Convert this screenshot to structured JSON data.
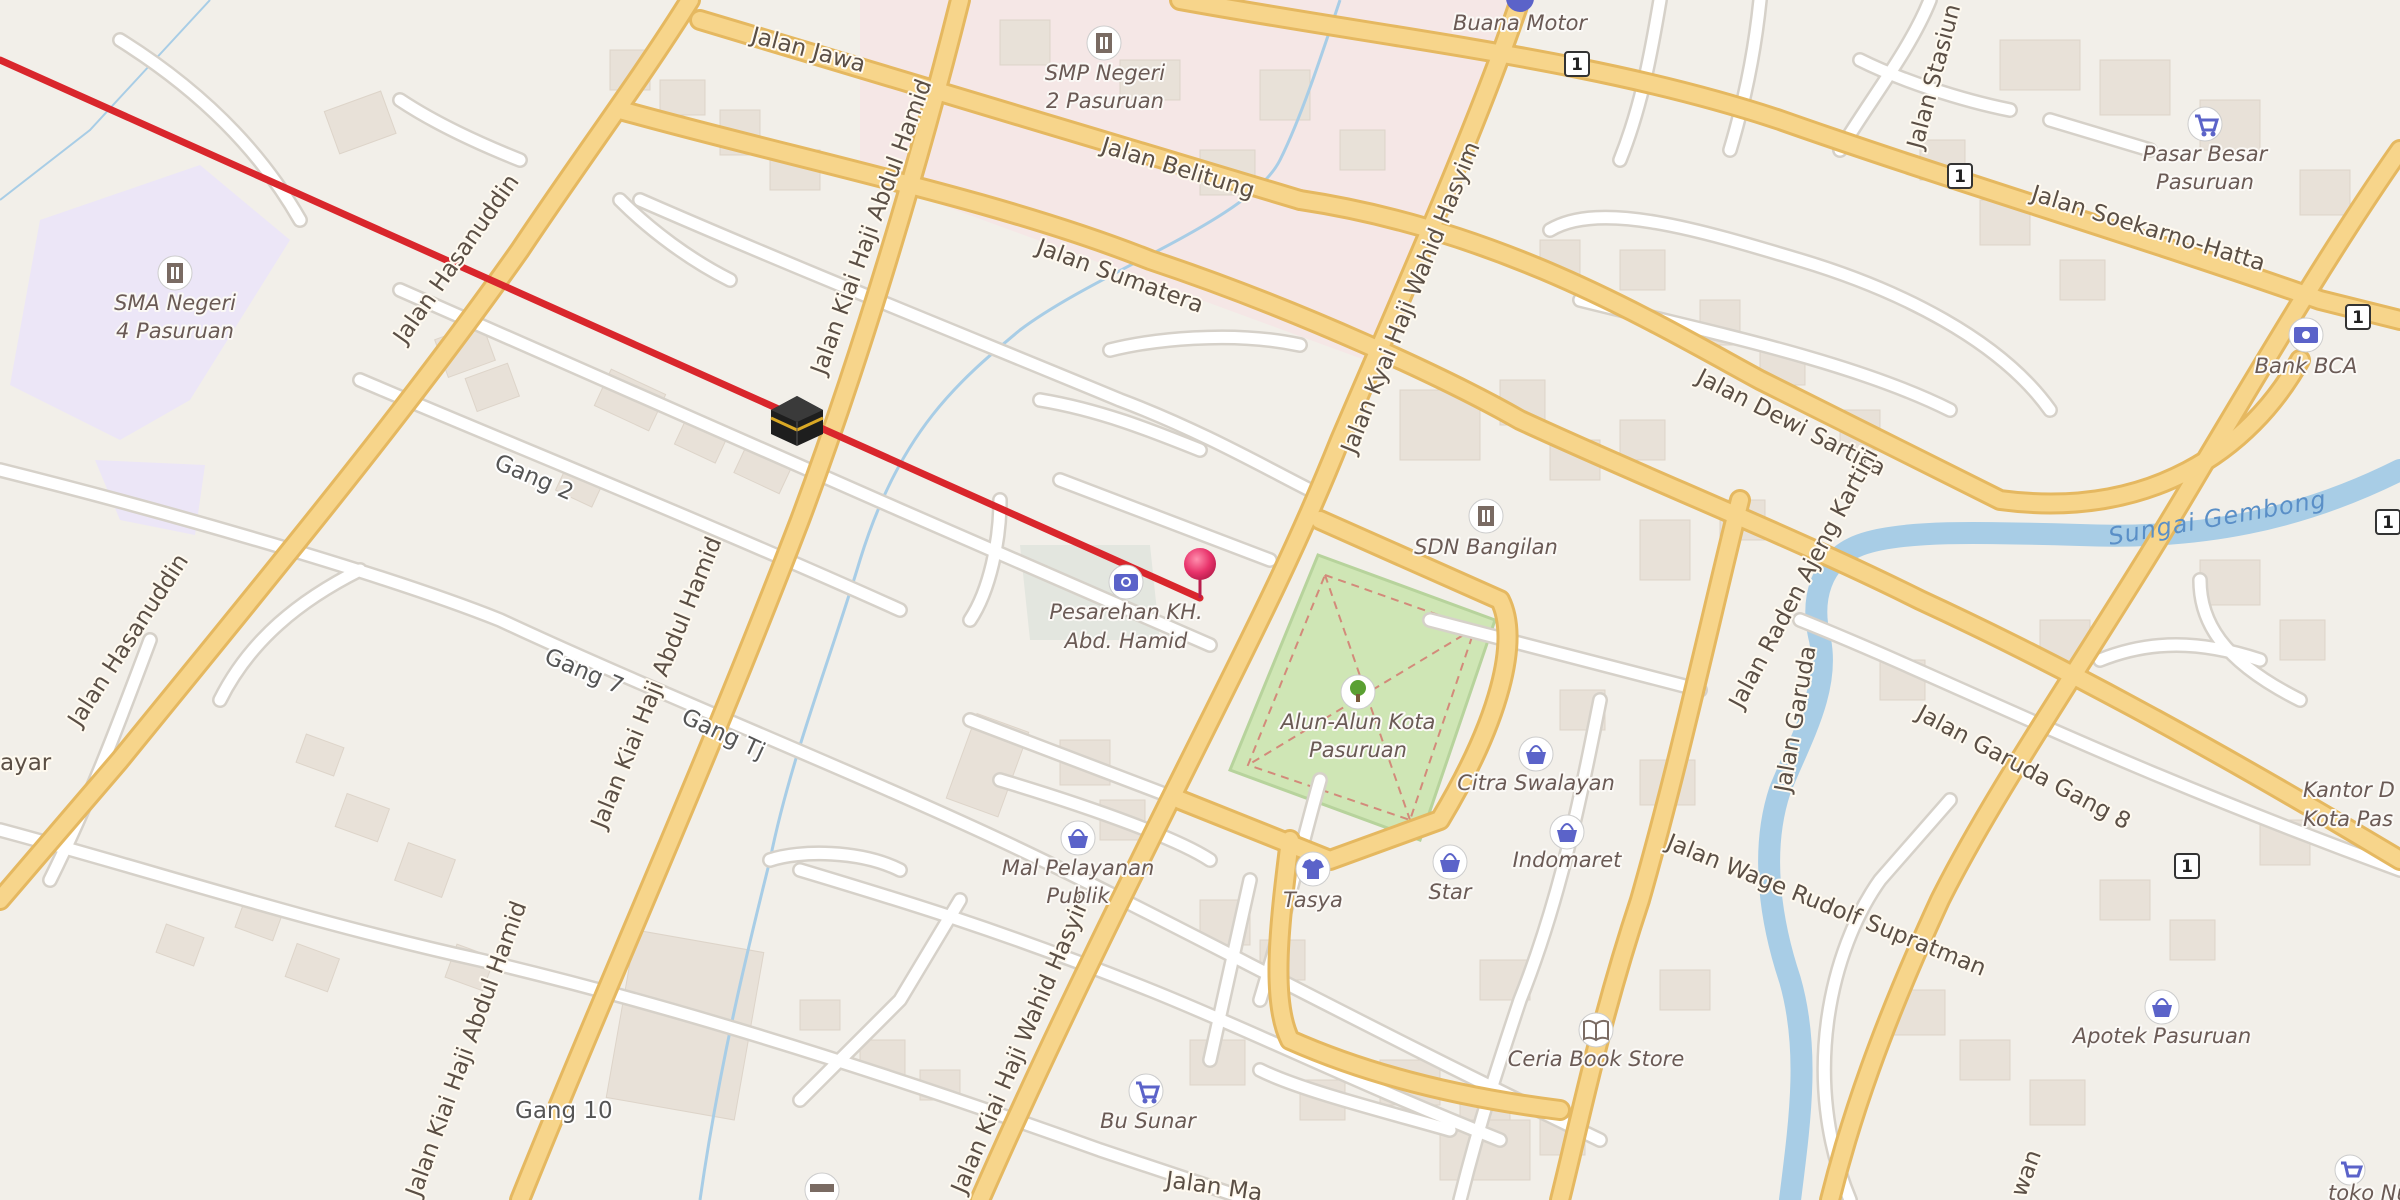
{
  "map": {
    "colors": {
      "background": "#f2efe9",
      "major_road": "#f7d58b",
      "major_road_casing": "#e5b860",
      "minor_road": "#ffffff",
      "minor_road_casing": "#d6d1c9",
      "building": "#e8e1d8",
      "water": "#a8cde6",
      "park": "#cfe6b5",
      "school_area": "#ece6f7",
      "commercial_area": "#f4e6e6",
      "route_line": "#d9262c",
      "pin": "#e8336b",
      "poi_shop": "#5b63c9",
      "poi_school": "#7a6b63",
      "poi_park": "#5aa032"
    },
    "road_labels": [
      {
        "id": "jalan-jawa",
        "text": "Jalan Jawa"
      },
      {
        "id": "jalan-belitung",
        "text": "Jalan Belitung"
      },
      {
        "id": "jalan-sumatera",
        "text": "Jalan Sumatera"
      },
      {
        "id": "jalan-hasanuddin-top",
        "text": "Jalan Hasanuddin"
      },
      {
        "id": "jalan-hasanuddin-bottom",
        "text": "Jalan Hasanuddin"
      },
      {
        "id": "jalan-kh-abdul-hamid-top",
        "text": "Jalan Kiai Haji Abdul Hamid"
      },
      {
        "id": "jalan-kh-abdul-hamid-mid",
        "text": "Jalan Kiai Haji Abdul Hamid"
      },
      {
        "id": "jalan-kh-abdul-hamid-bottom",
        "text": "Jalan Kiai Haji Abdul Hamid"
      },
      {
        "id": "jalan-kh-wahid-hasyim-top",
        "text": "Jalan Kyai Haji Wahid Hasyim"
      },
      {
        "id": "jalan-kh-wahid-hasyim-bottom",
        "text": "Jalan Kiai Haji Wahid Hasyim"
      },
      {
        "id": "jalan-dewi-sartika",
        "text": "Jalan Dewi Sartika"
      },
      {
        "id": "jalan-soekarno-hatta",
        "text": "Jalan Soekarno-Hatta"
      },
      {
        "id": "jalan-stasiun",
        "text": "Jalan Stasiun"
      },
      {
        "id": "jalan-raden-ajeng-kartini",
        "text": "Jalan Raden Ajeng Kartini"
      },
      {
        "id": "jalan-garuda",
        "text": "Jalan Garuda"
      },
      {
        "id": "jalan-garuda-gang-8",
        "text": "Jalan Garuda Gang 8"
      },
      {
        "id": "jalan-wage-rudolf-supratman",
        "text": "Jalan Wage Rudolf Supratman"
      },
      {
        "id": "gang-2",
        "text": "Gang 2"
      },
      {
        "id": "gang-7",
        "text": "Gang 7"
      },
      {
        "id": "gang-tj",
        "text": "Gang Tj"
      },
      {
        "id": "gang-10",
        "text": "Gang 10"
      },
      {
        "id": "jalan-ma-bottom",
        "text": "Jalan Ma"
      },
      {
        "id": "wan-bottom",
        "text": "wan"
      },
      {
        "id": "ayar-left",
        "text": "ayar"
      }
    ],
    "water_labels": [
      {
        "id": "sungai-gembong",
        "text": "Sungai Gembong"
      }
    ],
    "route_shields": [
      {
        "id": "shield-1",
        "text": "1"
      },
      {
        "id": "shield-2",
        "text": "1"
      },
      {
        "id": "shield-3",
        "text": "1"
      },
      {
        "id": "shield-4",
        "text": "1"
      },
      {
        "id": "shield-5",
        "text": "1"
      }
    ],
    "pois": [
      {
        "id": "buana-motor",
        "icon": "motorbike-shop-icon",
        "lines": [
          "Buana Motor"
        ]
      },
      {
        "id": "smp-negeri-2",
        "icon": "school-icon",
        "lines": [
          "SMP Negeri",
          "2 Pasuruan"
        ]
      },
      {
        "id": "sma-negeri-4",
        "icon": "school-icon",
        "lines": [
          "SMA Negeri",
          "4 Pasuruan"
        ]
      },
      {
        "id": "pasar-besar",
        "icon": "shopping-cart-icon",
        "lines": [
          "Pasar Besar",
          "Pasuruan"
        ]
      },
      {
        "id": "bank-bca",
        "icon": "bank-icon",
        "lines": [
          "Bank BCA"
        ]
      },
      {
        "id": "sdn-bangilan",
        "icon": "school-icon",
        "lines": [
          "SDN Bangilan"
        ]
      },
      {
        "id": "pesarehan",
        "icon": "camera-icon",
        "lines": [
          "Pesarehan KH.",
          "Abd. Hamid"
        ]
      },
      {
        "id": "alun-alun",
        "icon": "tree-icon",
        "lines": [
          "Alun-Alun Kota",
          "Pasuruan"
        ]
      },
      {
        "id": "citra-swalayan",
        "icon": "shopping-basket-icon",
        "lines": [
          "Citra Swalayan"
        ]
      },
      {
        "id": "indomaret",
        "icon": "shopping-basket-icon",
        "lines": [
          "Indomaret"
        ]
      },
      {
        "id": "mal-pelayanan",
        "icon": "shopping-basket-icon",
        "lines": [
          "Mal Pelayanan",
          "Publik"
        ]
      },
      {
        "id": "tasya",
        "icon": "clothes-icon",
        "lines": [
          "Tasya"
        ]
      },
      {
        "id": "star",
        "icon": "shopping-basket-icon",
        "lines": [
          "Star"
        ]
      },
      {
        "id": "ceria-book-store",
        "icon": "book-icon",
        "lines": [
          "Ceria Book Store"
        ]
      },
      {
        "id": "apotek",
        "icon": "shopping-basket-icon",
        "lines": [
          "Apotek Pasuruan"
        ]
      },
      {
        "id": "kantor",
        "icon": "office-icon",
        "lines": [
          "Kantor D",
          "Kota Pas"
        ]
      },
      {
        "id": "bu-sunar",
        "icon": "shopping-cart-icon",
        "lines": [
          "Bu Sunar"
        ]
      },
      {
        "id": "toko-nusa",
        "icon": "shopping-cart-icon",
        "lines": [
          "toko Nusa D"
        ]
      }
    ],
    "markers": {
      "kaaba": {
        "icon": "kaaba-icon"
      },
      "pin": {
        "icon": "map-pin-icon"
      }
    }
  }
}
